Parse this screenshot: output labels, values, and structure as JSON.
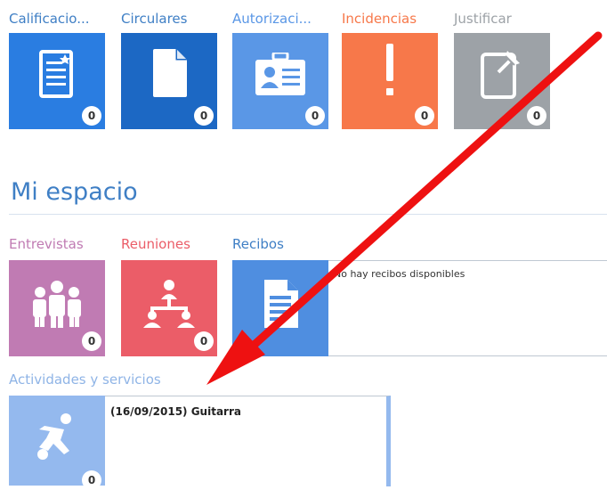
{
  "top_tiles": [
    {
      "label": "Calificacio...",
      "count": "0",
      "icon": "document-report-icon",
      "color": "#2a7de1",
      "label_color": "#3f7fc5"
    },
    {
      "label": "Circulares",
      "count": "0",
      "icon": "blank-page-icon",
      "color": "#1c68c4",
      "label_color": "#3f7fc5"
    },
    {
      "label": "Autorizaci...",
      "count": "0",
      "icon": "id-badge-icon",
      "color": "#5a97e6",
      "label_color": "#5a97e6"
    },
    {
      "label": "Incidencias",
      "count": "0",
      "icon": "exclamation-icon",
      "color": "#f7784a",
      "label_color": "#f7784a"
    },
    {
      "label": "Justificar",
      "count": "0",
      "icon": "pinned-note-icon",
      "color": "#9da2a7",
      "label_color": "#9da2a7"
    }
  ],
  "section": {
    "title": "Mi espacio"
  },
  "mi_espacio_tiles": [
    {
      "label": "Entrevistas",
      "count": "0",
      "icon": "group-people-icon",
      "color": "#c07bb3",
      "label_color": "#c07bb3"
    },
    {
      "label": "Reuniones",
      "count": "0",
      "icon": "network-people-icon",
      "color": "#eb5d68",
      "label_color": "#eb5d68"
    },
    {
      "label": "Recibos",
      "icon": "receipt-document-icon",
      "color": "#4f8ee0",
      "label_color": "#3f7fc5",
      "empty_text": "No hay recibos disponibles"
    }
  ],
  "activities": {
    "label": "Actividades y servicios",
    "label_color": "#8fb4e6",
    "count": "0",
    "icon": "soccer-player-icon",
    "color": "#94b9ee",
    "items": [
      "(16/09/2015) Guitarra"
    ]
  },
  "annotation": {
    "arrow_color": "#ee1111"
  }
}
